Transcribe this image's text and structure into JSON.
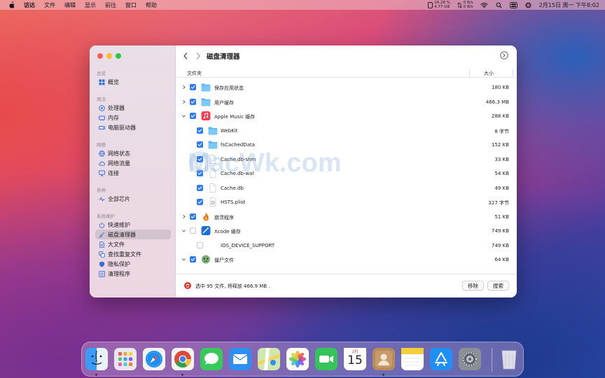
{
  "menubar": {
    "app_name": "访达",
    "items": [
      "文件",
      "编辑",
      "显示",
      "前往",
      "窗口",
      "帮助"
    ],
    "stats": {
      "cpu": "24.28 %",
      "mem": "4.77 GB",
      "net_up": "0 B/s",
      "net_down": "0 B/s"
    },
    "clock": "2月15日 周一 下午8:02"
  },
  "sidebar": {
    "sections": [
      {
        "title": "总览",
        "items": [
          {
            "label": "概览",
            "icon": "grid-icon"
          }
        ]
      },
      {
        "title": "用法",
        "items": [
          {
            "label": "处理器",
            "icon": "cpu-icon"
          },
          {
            "label": "内存",
            "icon": "memory-icon"
          },
          {
            "label": "电脑驱动器",
            "icon": "drive-icon"
          }
        ]
      },
      {
        "title": "网络",
        "items": [
          {
            "label": "网络状态",
            "icon": "globe-icon"
          },
          {
            "label": "网络流量",
            "icon": "cloud-icon"
          },
          {
            "label": "连接",
            "icon": "monitor-icon"
          }
        ]
      },
      {
        "title": "各种",
        "items": [
          {
            "label": "全部芯片",
            "icon": "pulse-icon"
          }
        ]
      },
      {
        "title": "系统维护",
        "items": [
          {
            "label": "快速维护",
            "icon": "power-icon"
          },
          {
            "label": "磁盘清理器",
            "icon": "brush-icon"
          },
          {
            "label": "大文件",
            "icon": "file-icon"
          },
          {
            "label": "查找重复文件",
            "icon": "duplicate-icon"
          },
          {
            "label": "隐私保护",
            "icon": "shield-icon"
          },
          {
            "label": "清理程序",
            "icon": "list-icon"
          }
        ]
      }
    ],
    "active": "磁盘清理器"
  },
  "main": {
    "title": "磁盘清理器",
    "columns": {
      "folder": "文件夹",
      "size": "大小"
    },
    "rows": [
      {
        "name": "保存应用状态",
        "size": "180 KB",
        "level": 0,
        "checked": true,
        "icon": "folder-icon",
        "chevron": "right"
      },
      {
        "name": "用户缓存",
        "size": "466.3 MB",
        "level": 0,
        "checked": true,
        "icon": "folder-icon",
        "chevron": "right"
      },
      {
        "name": "Apple Music 缓存",
        "size": "288 KB",
        "level": 0,
        "checked": true,
        "icon": "music-icon",
        "chevron": "down"
      },
      {
        "name": "WebKit",
        "size": "8 字节",
        "level": 1,
        "checked": true,
        "icon": "folder-icon"
      },
      {
        "name": "fsCachedData",
        "size": "152 KB",
        "level": 1,
        "checked": true,
        "icon": "folder-icon"
      },
      {
        "name": "Cache.db-shm",
        "size": "33 KB",
        "level": 1,
        "checked": true,
        "icon": "doc-icon"
      },
      {
        "name": "Cache.db-wal",
        "size": "54 KB",
        "level": 1,
        "checked": true,
        "icon": "doc-icon"
      },
      {
        "name": "Cache.db",
        "size": "49 KB",
        "level": 1,
        "checked": true,
        "icon": "doc-icon"
      },
      {
        "name": "HSTS.plist",
        "size": "327 字节",
        "level": 1,
        "checked": true,
        "icon": "plist-icon"
      },
      {
        "name": "崩溃程序",
        "size": "51 KB",
        "level": 0,
        "checked": true,
        "icon": "fire-icon",
        "chevron": "right"
      },
      {
        "name": "Xcode 缓存",
        "size": "749 KB",
        "level": 0,
        "checked": false,
        "icon": "xcode-icon",
        "chevron": "down"
      },
      {
        "name": "IOS_DEVICE_SUPPORT",
        "size": "749 KB",
        "level": 1,
        "checked": false,
        "icon": "none"
      },
      {
        "name": "僵尸文件",
        "size": "64 KB",
        "level": 0,
        "checked": true,
        "icon": "zombie-icon",
        "chevron": "down"
      }
    ],
    "status": "选中 95 文件, 将释放 466.9 MB .",
    "remove_label": "移除",
    "search_label": "搜索"
  },
  "watermark": "MacWk.com",
  "dock": {
    "apps": [
      "finder-icon",
      "launchpad-icon",
      "safari-icon",
      "chrome-icon",
      "messages-icon",
      "mail-icon",
      "maps-icon",
      "photos-icon",
      "facetime-icon",
      "calendar-icon",
      "contacts-icon",
      "notes-icon",
      "appstore-icon",
      "settings-icon",
      "trash-icon"
    ],
    "calendar_month": "2月",
    "calendar_day": "15"
  }
}
